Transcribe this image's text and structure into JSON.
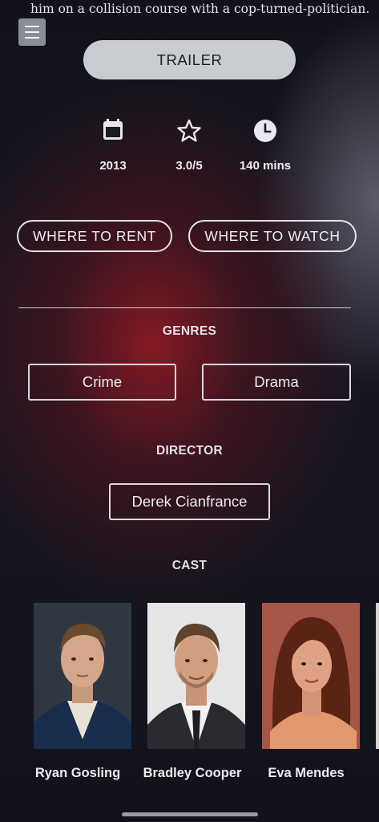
{
  "synopsis_text": "him on a collision course with a cop-turned-politician.",
  "menu": {
    "icon": "hamburger-menu-icon"
  },
  "trailer_button_label": "TRAILER",
  "stats": {
    "year": "2013",
    "rating": "3.0/5",
    "runtime": "140 mins"
  },
  "buttons": {
    "where_to_rent": "WHERE TO RENT",
    "where_to_watch": "WHERE TO WATCH"
  },
  "genres": {
    "title": "GENRES",
    "items": [
      "Crime",
      "Drama"
    ]
  },
  "director": {
    "title": "DIRECTOR",
    "name": "Derek Cianfrance"
  },
  "cast": {
    "title": "CAST",
    "members": [
      {
        "name": "Ryan Gosling"
      },
      {
        "name": "Bradley Cooper"
      },
      {
        "name": "Eva Mendes"
      }
    ]
  },
  "colors": {
    "accent_red": "#8c1a24",
    "background": "#14141c",
    "trailer_button": "#c9ccd1"
  }
}
